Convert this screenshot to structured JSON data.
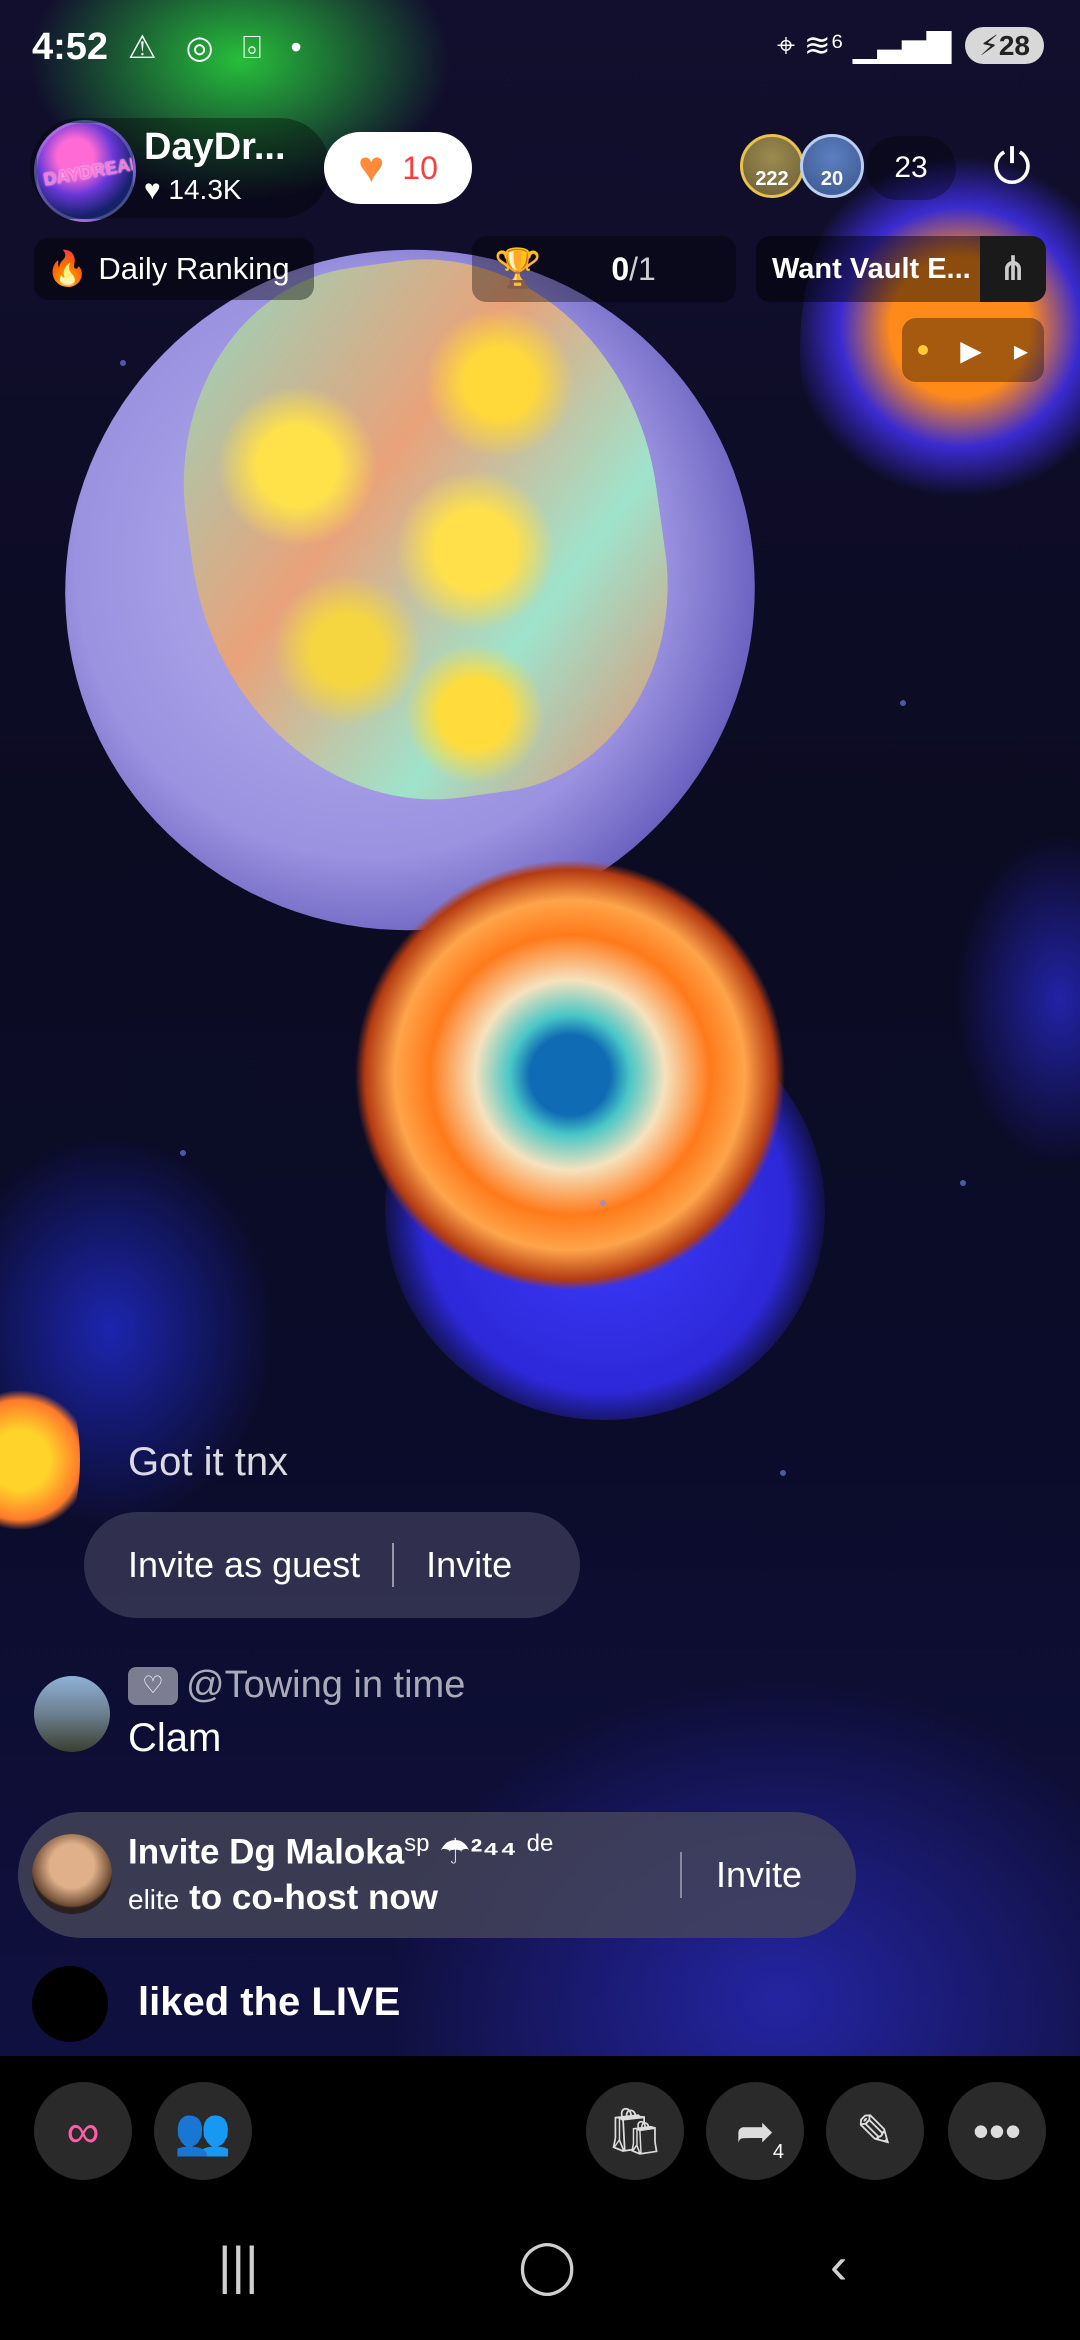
{
  "status_bar": {
    "time": "4:52",
    "left_icons": "⚠ ◎ ⌻ •",
    "right_icons": "⌖ ≋⁶ ▁▃▅▇",
    "battery": "⚡28"
  },
  "host": {
    "avatar_text": "DAYDREAM",
    "name": "DayDr...",
    "likes": "♥ 14.3K",
    "follow_count": "10"
  },
  "viewers": {
    "avatar1_badge": "222",
    "avatar2_badge": "20",
    "count": "23"
  },
  "chips": {
    "daily_ranking": "Daily Ranking",
    "goal_current": "0",
    "goal_total": "/1",
    "promo": "Want Vault E..."
  },
  "comments": {
    "partial": "Got it tnx",
    "invite_guest_label": "Invite as guest",
    "invite_label": "Invite",
    "user": "@Towing in time",
    "text": "Clam"
  },
  "cohost": {
    "line1_prefix": "Invite Dg  Maloka",
    "sup1": "sp",
    "line1_mid": " ☂²⁴⁴",
    "sup2": "de",
    "line2_sub": "elite",
    "line2": " to co-host now",
    "invite": "Invite"
  },
  "like_event": {
    "text": "liked the LIVE"
  },
  "toolbar": {
    "multiguest_icon": "link-icon",
    "guests_icon": "people-icon",
    "shop_icon": "bag-icon",
    "share_icon": "share-icon",
    "share_count": "4",
    "effects_icon": "magic-wand-icon",
    "more_icon": "more-icon"
  },
  "nav": {
    "recents": "|||",
    "home": "◯",
    "back": "‹"
  }
}
